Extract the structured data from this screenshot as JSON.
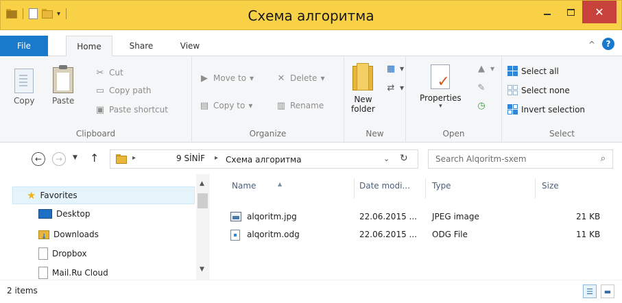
{
  "window": {
    "title": "Схема алгоритма",
    "close_glyph": "✕"
  },
  "ribbon_tabs": {
    "file": "File",
    "home": "Home",
    "share": "Share",
    "view": "View"
  },
  "help_glyph": "?",
  "ribbon": {
    "clipboard": {
      "copy": "Copy",
      "paste": "Paste",
      "cut": "Cut",
      "copy_path": "Copy path",
      "paste_shortcut": "Paste shortcut",
      "label": "Clipboard"
    },
    "organize": {
      "move_to": "Move to",
      "copy_to": "Copy to",
      "delete": "Delete",
      "rename": "Rename",
      "label": "Organize"
    },
    "new": {
      "new_folder_line1": "New",
      "new_folder_line2": "folder",
      "label": "New"
    },
    "open": {
      "properties": "Properties",
      "label": "Open"
    },
    "select": {
      "select_all": "Select all",
      "select_none": "Select none",
      "invert_selection": "Invert selection",
      "label": "Select"
    }
  },
  "address": {
    "segment1": "9 SİNİF",
    "segment2": "Схема алгоритма"
  },
  "search": {
    "placeholder": "Search Alqoritm-sxem"
  },
  "nav_pane": {
    "favorites": "Favorites",
    "items": [
      "Desktop",
      "Downloads",
      "Dropbox",
      "Mail.Ru Cloud"
    ]
  },
  "file_list": {
    "columns": {
      "name": "Name",
      "date": "Date modi...",
      "type": "Type",
      "size": "Size"
    },
    "rows": [
      {
        "name": "alqoritm.jpg",
        "date": "22.06.2015 ...",
        "type": "JPEG image",
        "size": "21 KB"
      },
      {
        "name": "alqoritm.odg",
        "date": "22.06.2015 ...",
        "type": "ODG File",
        "size": "11 KB"
      }
    ]
  },
  "status": {
    "items_count": "2 items"
  },
  "colors": {
    "titlebar": "#f8d146",
    "file_tab": "#1979ca",
    "close_button": "#c7423a",
    "selection": "#e5f3fb"
  }
}
